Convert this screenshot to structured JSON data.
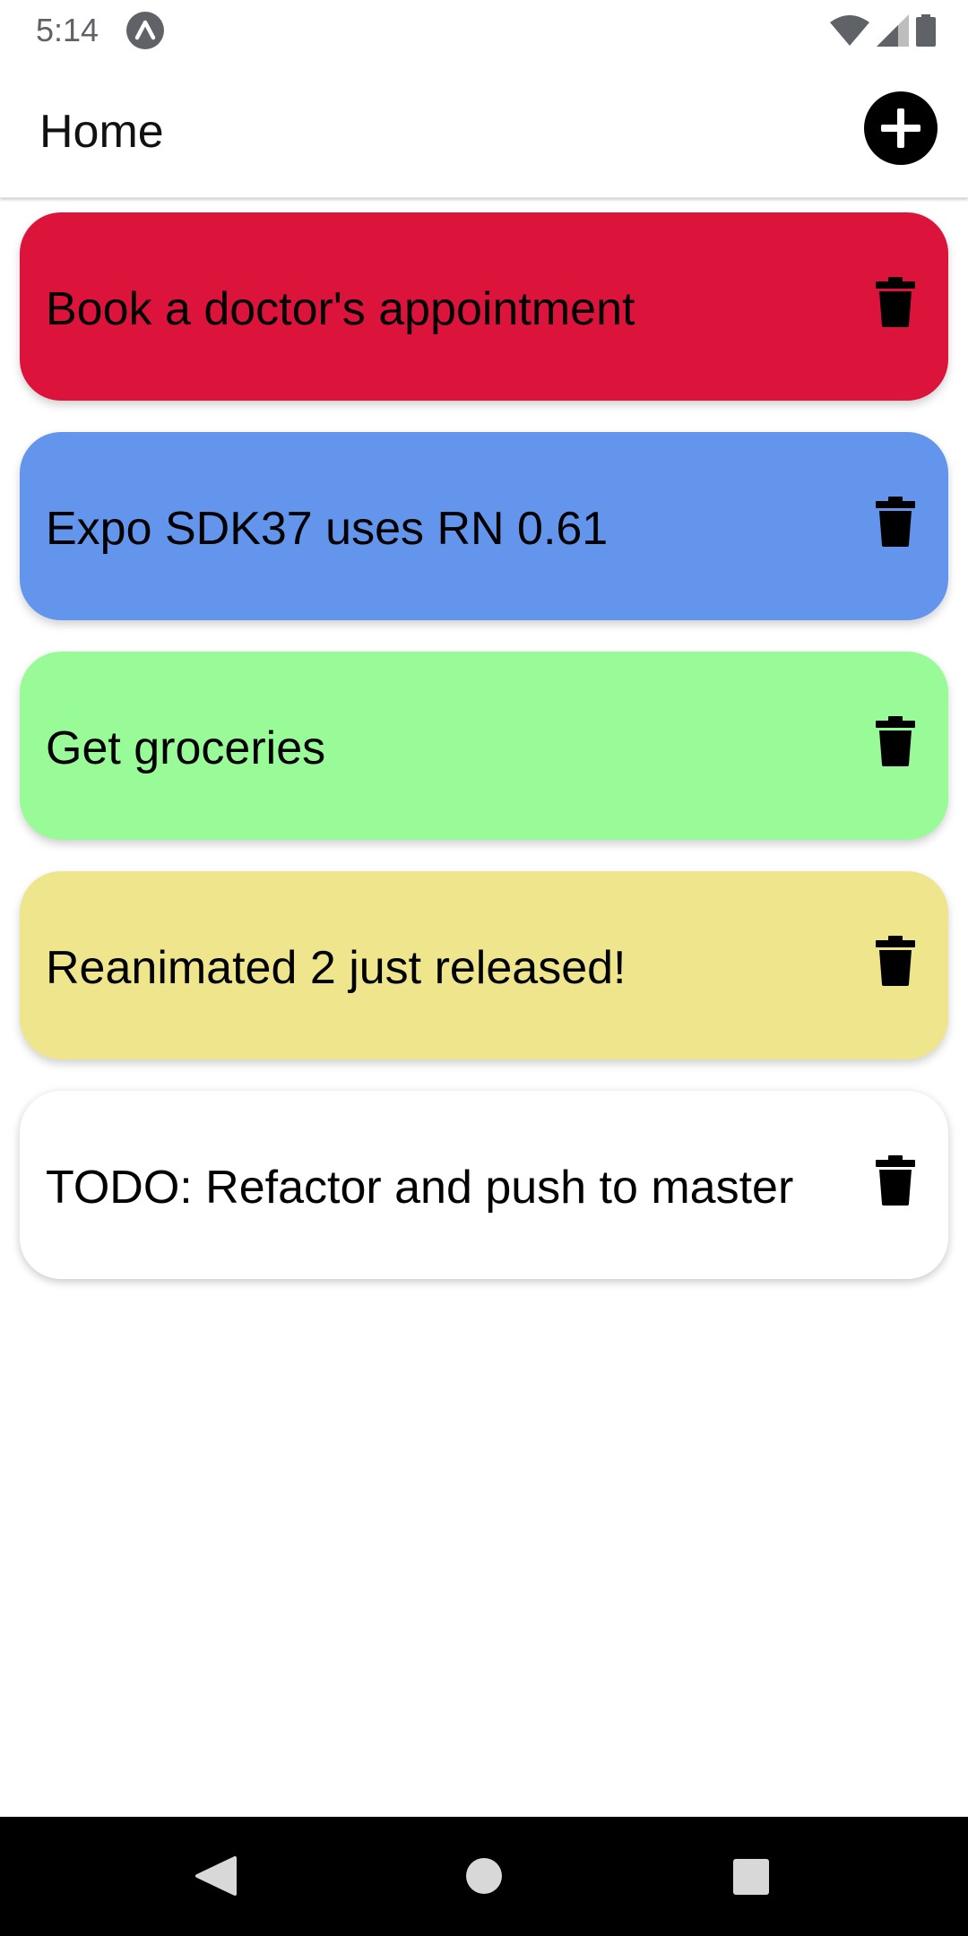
{
  "status_bar": {
    "time": "5:14",
    "app_icon": "expo-icon",
    "wifi_icon": "wifi-icon",
    "signal_icon": "cell-signal-icon",
    "battery_icon": "battery-icon"
  },
  "header": {
    "title": "Home",
    "add_icon": "plus-circle-icon"
  },
  "notes": [
    {
      "text": "Book a doctor's appointment",
      "color": "#DC143C"
    },
    {
      "text": "Expo SDK37 uses RN 0.61",
      "color": "#6495ED"
    },
    {
      "text": "Get groceries",
      "color": "#98FB98"
    },
    {
      "text": "Reanimated 2 just released!",
      "color": "#EEE58C"
    },
    {
      "text": "TODO: Refactor and push to master",
      "color": "#FFFFFF"
    }
  ],
  "note_delete_icon": "trash-icon",
  "nav_bar": {
    "back_icon": "back-triangle-icon",
    "home_icon": "home-circle-icon",
    "recents_icon": "recents-square-icon"
  }
}
